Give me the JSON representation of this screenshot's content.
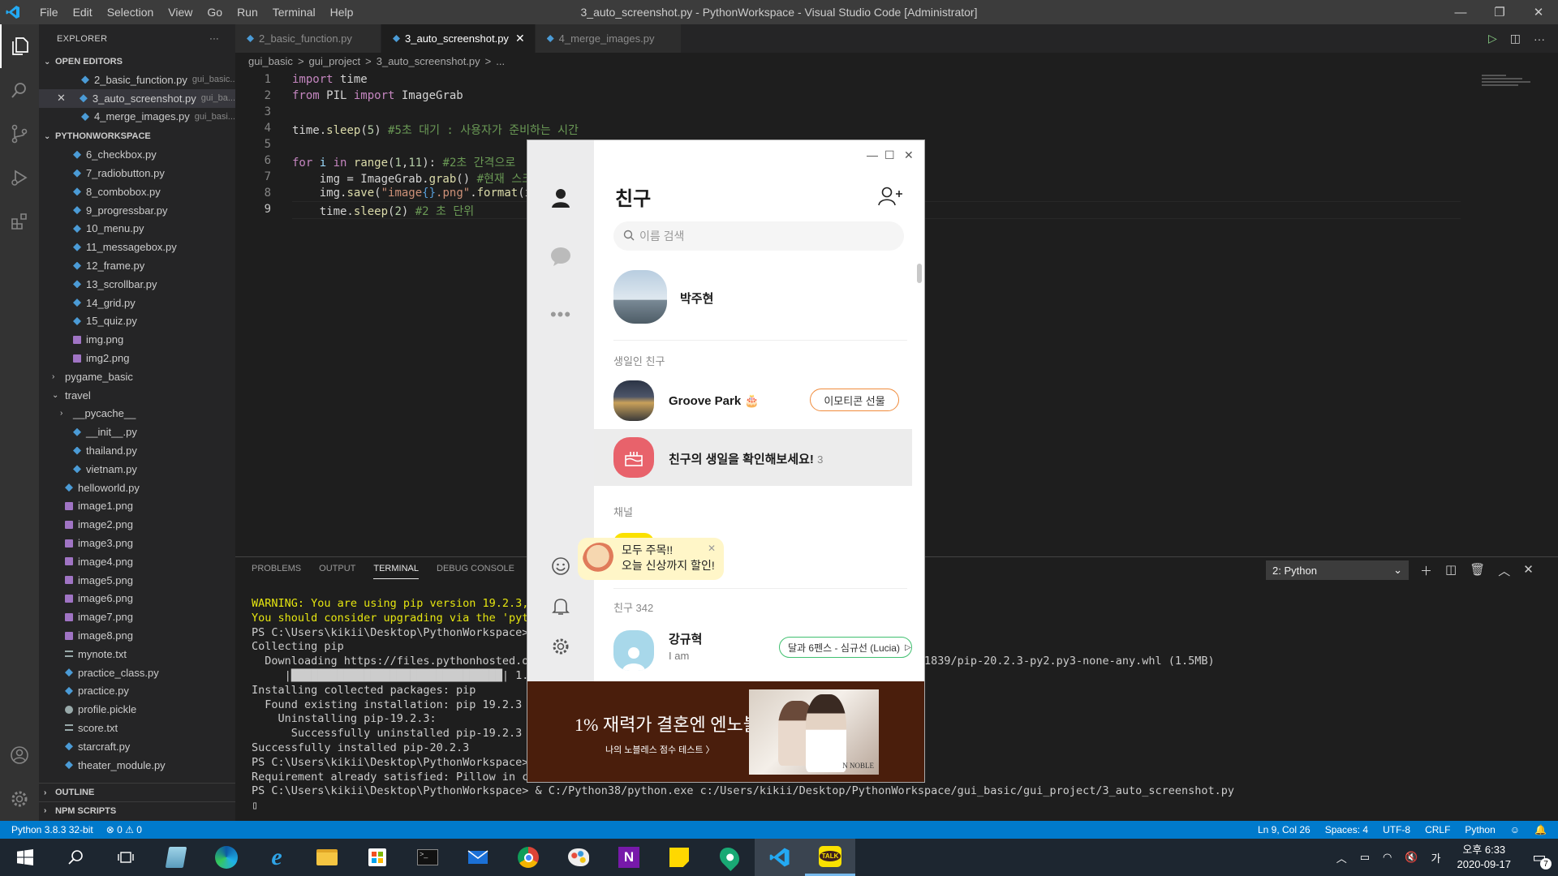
{
  "window": {
    "title": "3_auto_screenshot.py - PythonWorkspace - Visual Studio Code [Administrator]",
    "menu": [
      "File",
      "Edit",
      "Selection",
      "View",
      "Go",
      "Run",
      "Terminal",
      "Help"
    ]
  },
  "explorer": {
    "header": "EXPLORER",
    "more": "···",
    "open_editors_title": "OPEN EDITORS",
    "open_editors": [
      {
        "name": "2_basic_function.py",
        "desc": "gui_basic..."
      },
      {
        "name": "3_auto_screenshot.py",
        "desc": "gui_ba..."
      },
      {
        "name": "4_merge_images.py",
        "desc": "gui_basi..."
      }
    ],
    "workspace_title": "PYTHONWORKSPACE",
    "files": [
      {
        "name": "6_checkbox.py",
        "t": "py",
        "i": 1
      },
      {
        "name": "7_radiobutton.py",
        "t": "py",
        "i": 1
      },
      {
        "name": "8_combobox.py",
        "t": "py",
        "i": 1
      },
      {
        "name": "9_progressbar.py",
        "t": "py",
        "i": 1
      },
      {
        "name": "10_menu.py",
        "t": "py",
        "i": 1
      },
      {
        "name": "11_messagebox.py",
        "t": "py",
        "i": 1
      },
      {
        "name": "12_frame.py",
        "t": "py",
        "i": 1
      },
      {
        "name": "13_scrollbar.py",
        "t": "py",
        "i": 1
      },
      {
        "name": "14_grid.py",
        "t": "py",
        "i": 1
      },
      {
        "name": "15_quiz.py",
        "t": "py",
        "i": 1
      },
      {
        "name": "img.png",
        "t": "img",
        "i": 1
      },
      {
        "name": "img2.png",
        "t": "img",
        "i": 1
      },
      {
        "name": "pygame_basic",
        "t": "dir",
        "i": 0
      },
      {
        "name": "travel",
        "t": "diro",
        "i": 0
      },
      {
        "name": "__pycache__",
        "t": "dir",
        "i": 1
      },
      {
        "name": "__init__.py",
        "t": "py",
        "i": 1
      },
      {
        "name": "thailand.py",
        "t": "py",
        "i": 1
      },
      {
        "name": "vietnam.py",
        "t": "py",
        "i": 1
      },
      {
        "name": "helloworld.py",
        "t": "py",
        "i": 0
      },
      {
        "name": "image1.png",
        "t": "img",
        "i": 0
      },
      {
        "name": "image2.png",
        "t": "img",
        "i": 0
      },
      {
        "name": "image3.png",
        "t": "img",
        "i": 0
      },
      {
        "name": "image4.png",
        "t": "img",
        "i": 0
      },
      {
        "name": "image5.png",
        "t": "img",
        "i": 0
      },
      {
        "name": "image6.png",
        "t": "img",
        "i": 0
      },
      {
        "name": "image7.png",
        "t": "img",
        "i": 0
      },
      {
        "name": "image8.png",
        "t": "img",
        "i": 0
      },
      {
        "name": "mynote.txt",
        "t": "txt",
        "i": 0
      },
      {
        "name": "practice_class.py",
        "t": "py",
        "i": 0
      },
      {
        "name": "practice.py",
        "t": "py",
        "i": 0
      },
      {
        "name": "profile.pickle",
        "t": "pk",
        "i": 0
      },
      {
        "name": "score.txt",
        "t": "txt",
        "i": 0
      },
      {
        "name": "starcraft.py",
        "t": "py",
        "i": 0
      },
      {
        "name": "theater_module.py",
        "t": "py",
        "i": 0
      }
    ],
    "outline": "OUTLINE",
    "npm": "NPM SCRIPTS"
  },
  "tabs": [
    {
      "label": "2_basic_function.py"
    },
    {
      "label": "3_auto_screenshot.py",
      "close": "✕"
    },
    {
      "label": "4_merge_images.py"
    }
  ],
  "breadcrumb": [
    "gui_basic",
    ">",
    "gui_project",
    ">",
    "3_auto_screenshot.py",
    ">",
    "..."
  ],
  "code": {
    "lines": [
      "1",
      "2",
      "3",
      "4",
      "5",
      "6",
      "7",
      "8",
      "9"
    ],
    "l1a": "import",
    "l1b": " time",
    "l2a": "from",
    "l2b": " PIL ",
    "l2c": "import",
    "l2d": " ImageGrab",
    "l4a": "time.",
    "l4b": "sleep",
    "l4c": "(",
    "l4d": "5",
    "l4e": ") ",
    "l4f": "#5초 대기 : 사용자가 준비하는 시간",
    "l6a": "for",
    "l6b": " i ",
    "l6c": "in",
    "l6d": " ",
    "l6e": "range",
    "l6f": "(",
    "l6g": "1",
    "l6h": ",",
    "l6i": "11",
    "l6j": "): ",
    "l6k": "#2초 간격으로",
    "l7a": "    img = ImageGrab.",
    "l7b": "grab",
    "l7c": "() ",
    "l7d": "#현재 스크",
    "l8a": "    img.",
    "l8b": "save",
    "l8c": "(",
    "l8d": "\"image",
    "l8e": "{}",
    "l8f": ".png\"",
    "l8g": ".",
    "l8h": "format",
    "l8i": "(i)",
    "l9a": "    time.",
    "l9b": "sleep",
    "l9c": "(",
    "l9d": "2",
    "l9e": ") ",
    "l9f": "#2 초 단위"
  },
  "panel": {
    "tabs": [
      "PROBLEMS",
      "OUTPUT",
      "TERMINAL",
      "DEBUG CONSOLE"
    ],
    "terminal_select": "2: Python",
    "term": [
      {
        "c": "yw",
        "t": "WARNING: You are using pip version 19.2.3, "
      },
      {
        "c": "yw",
        "t": "You should consider upgrading via the 'pyt"
      },
      {
        "c": "",
        "t": "PS C:\\Users\\kikii\\Desktop\\PythonWorkspace>"
      },
      {
        "c": "",
        "t": "Collecting pip"
      },
      {
        "c": "",
        "t": "  Downloading https://files.pythonhosted.or                                               905de621c9f81839/pip-20.2.3-py2.py3-none-any.whl (1.5MB)"
      },
      {
        "c": "",
        "t": "     |████████████████████████████████| 1."
      },
      {
        "c": "",
        "t": "Installing collected packages: pip"
      },
      {
        "c": "",
        "t": "  Found existing installation: pip 19.2.3"
      },
      {
        "c": "",
        "t": "    Uninstalling pip-19.2.3:"
      },
      {
        "c": "",
        "t": "      Successfully uninstalled pip-19.2.3"
      },
      {
        "c": "",
        "t": "Successfully installed pip-20.2.3"
      },
      {
        "c": "",
        "t": "PS C:\\Users\\kikii\\Desktop\\PythonWorkspace>"
      },
      {
        "c": "",
        "t": "Requirement already satisfied: Pillow in c"
      },
      {
        "c": "",
        "t": "PS C:\\Users\\kikii\\Desktop\\PythonWorkspace> & C:/Python38/python.exe c:/Users/kikii/Desktop/PythonWorkspace/gui_basic/gui_project/3_auto_screenshot.py"
      },
      {
        "c": "",
        "t": "▯"
      }
    ]
  },
  "status": {
    "python": "Python 3.8.3 32-bit",
    "problems": "⊗ 0 ⚠ 0",
    "pos": "Ln 9, Col 26",
    "spaces": "Spaces: 4",
    "enc": "UTF-8",
    "eol": "CRLF",
    "lang": "Python"
  },
  "kakao": {
    "title": "친구",
    "search_placeholder": "이름 검색",
    "me": "박주현",
    "birthday_section": "생일인 친구",
    "bday_friend": "Groove Park",
    "bday_button": "이모티콘 선물",
    "bday_banner": "친구의 생일을 확인해보세요!",
    "bday_count": "3",
    "channel": "채널",
    "popup1": "모두 주목!!",
    "popup2": "오늘 신상까지 할인!",
    "friends_label": "친구",
    "friends_count": "342",
    "friend_name": "강규혁",
    "friend_status": "I am",
    "music_button": "달과 6펜스 - 심규선 (Lucia)",
    "ad_title": "1% 재력가 결혼엔 엔노블",
    "ad_sub": "나의 노블레스 점수 테스트 〉",
    "ad_logo": "N NOBLE"
  },
  "tray": {
    "time": "오후 6:33",
    "date": "2020-09-17",
    "ime": "가",
    "notif": "7"
  }
}
